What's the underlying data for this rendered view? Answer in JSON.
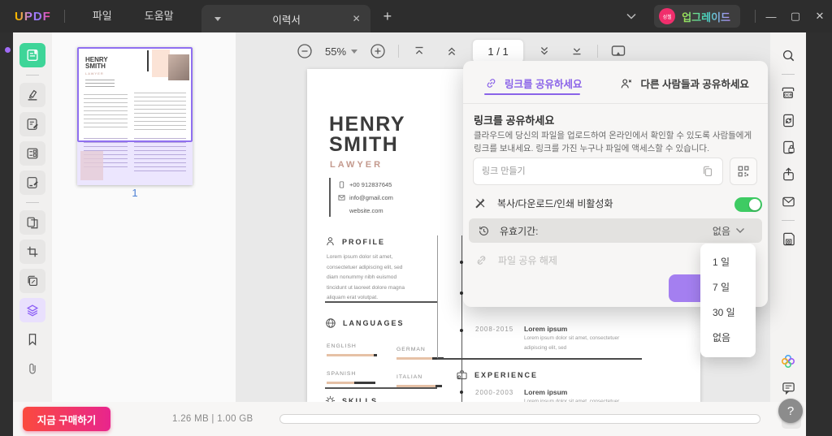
{
  "titlebar": {
    "logo": "UPDF",
    "menu_file": "파일",
    "menu_help": "도움말",
    "tab_title": "이력서",
    "upgrade_badge": "성첼",
    "upgrade_label": "업그레이드"
  },
  "glyphs": {
    "tab_close": "✕",
    "new_tab": "+",
    "minimize": "—",
    "maximize": "▢",
    "close": "✕",
    "status_plus": "+",
    "help": "?"
  },
  "toolbar": {
    "zoom_level": "55%",
    "page_indicator": "1 / 1"
  },
  "thumbnail_panel": {
    "page_number": "1"
  },
  "share_dialog": {
    "tab_share_link": "링크를 공유하세요",
    "tab_share_others": "다른 사람들과 공유하세요",
    "section_title": "링크를 공유하세요",
    "description": "클라우드에 당신의 파일을 업로드하여 온라인에서 확인할 수 있도록 사람들에게 링크를 보내세요. 링크를 가진 누구나 파일에 액세스할 수 있습니다.",
    "link_placeholder": "링크 만들기",
    "disable_copy_label": "복사/다운로드/인쇄 비활성화",
    "toggle_state": "on",
    "expiry_label": "유효기간:",
    "expiry_value": "없음",
    "unshare_label": "파일 공유 해제"
  },
  "expiry_dropdown": {
    "options": [
      "1 일",
      "7 일",
      "30 일",
      "없음"
    ]
  },
  "doc": {
    "name_line1": "HENRY",
    "name_line2": "SMITH",
    "role": "LAWYER",
    "phone": "+00 912837645",
    "email": "info@gmail.com",
    "website": "website.com",
    "profile_title": "PROFILE",
    "profile_text": "Lorem ipsum dolor sit amet, consectetuer adipiscing elit, sed diam nonummy nibh euismod tincidunt ut laoreet dolore magna aliquam erat volutpat.",
    "languages_title": "LANGUAGES",
    "lang1": "ENGLISH",
    "lang2": "GERMAN",
    "lang3": "SPANISH",
    "lang4": "ITALIAN",
    "skills_title": "SKILLS",
    "edu_years": "2008-2015",
    "edu_title": "Lorem ipsum",
    "edu_desc": "Lorem ipsum dolor sit amet, consectetuer adipiscing elit, sed",
    "experience_title": "EXPERIENCE",
    "exp_years": "2000-2003",
    "exp_title": "Lorem ipsum",
    "exp_desc": "Lorem ipsum dolor sit amet, consectetuer"
  },
  "statusbar": {
    "buy_label": "지금 구매하기",
    "file_size": "1.26 MB | 1.00 GB"
  },
  "icons": {
    "ocr_label": "OCR"
  },
  "colors": {
    "accent_purple": "#8a63e8",
    "toggle_green": "#3ecb63",
    "active_tool_green": "#3ed598",
    "buy_gradient_start": "#fb4a3e",
    "buy_gradient_end": "#e8258d",
    "titlebar_bg": "#2d2d2d",
    "page_number_blue": "#4a7fd4",
    "resume_accent": "#c49a8e"
  }
}
